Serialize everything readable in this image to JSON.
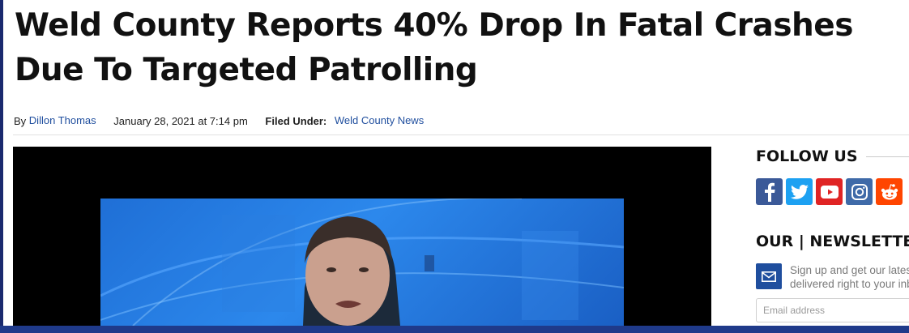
{
  "article": {
    "headline": "Weld County Reports 40% Drop In Fatal Crashes Due To Targeted Patrolling",
    "by_prefix": "By",
    "author": "Dillon Thomas",
    "date": "January 28, 2021 at 7:14 pm",
    "filed_label": "Filed Under:",
    "category": "Weld County News"
  },
  "sidebar": {
    "follow_heading": "FOLLOW US",
    "socials": [
      {
        "name": "facebook-icon",
        "color": "#3b5998"
      },
      {
        "name": "twitter-icon",
        "color": "#1da1f2"
      },
      {
        "name": "youtube-icon",
        "color": "#e02424"
      },
      {
        "name": "instagram-icon",
        "color": "#3f6aa8"
      },
      {
        "name": "reddit-icon",
        "color": "#ff4500"
      }
    ],
    "newsletter_heading": "OUR | NEWSLETTER",
    "newsletter_line1": "Sign up and get our latest",
    "newsletter_line2": "delivered right to your inbox",
    "email_placeholder": "Email address"
  },
  "colors": {
    "link": "#1f4e9e",
    "frame": "#1a2a6e"
  }
}
